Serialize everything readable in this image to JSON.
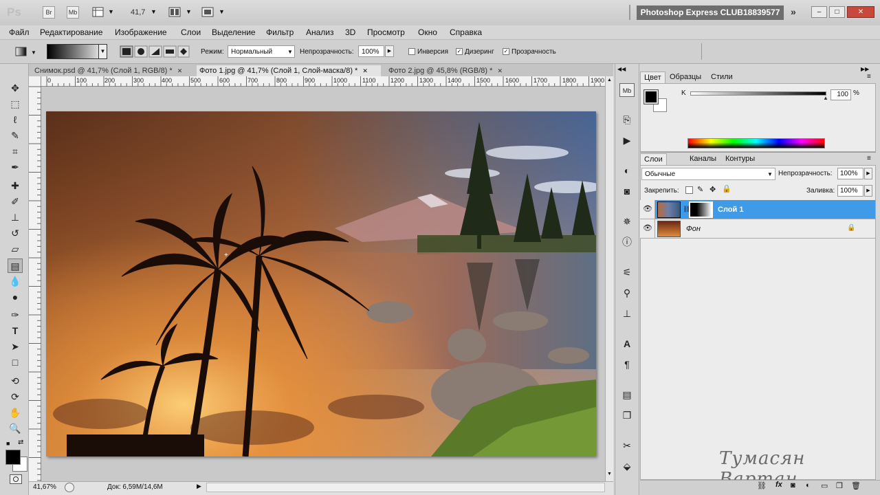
{
  "app": {
    "logo": "Ps",
    "bridge_label": "Br",
    "minibridge_label": "Mb",
    "zoom_value": "41,7",
    "workspace_name": "Photoshop Express CLUB18839577",
    "more_icon": "»"
  },
  "window_controls": {
    "minimize": "–",
    "maximize": "□",
    "close": "✕"
  },
  "menu": [
    "Файл",
    "Редактирование",
    "Изображение",
    "Слои",
    "Выделение",
    "Фильтр",
    "Анализ",
    "3D",
    "Просмотр",
    "Окно",
    "Справка"
  ],
  "options": {
    "mode_label": "Режим:",
    "mode_value": "Нормальный",
    "opacity_label": "Непрозрачность:",
    "opacity_value": "100%",
    "inverse_label": "Инверсия",
    "dither_label": "Дизеринг",
    "transparency_label": "Прозрачность",
    "inverse_checked": false,
    "dither_checked": true,
    "transparency_checked": true
  },
  "tabs": [
    {
      "label": "Снимок.psd @ 41,7% (Слой 1, RGB/8) *",
      "active": false
    },
    {
      "label": "Фото 1.jpg @ 41,7% (Слой 1, Слой-маска/8) *",
      "active": true
    },
    {
      "label": "Фото 2.jpg @ 45,8% (RGB/8) *",
      "active": false
    }
  ],
  "tab_close": "✕",
  "ruler_marks": [
    "0",
    "100",
    "200",
    "300",
    "400",
    "500",
    "600",
    "700",
    "800",
    "900",
    "1000",
    "1100",
    "1200",
    "1300",
    "1400",
    "1500",
    "1600",
    "1700",
    "1800",
    "1900"
  ],
  "status": {
    "zoom": "41,67%",
    "doc": "Док: 6,59M/14,6M"
  },
  "color_panel": {
    "tabs": [
      "Цвет",
      "Образцы",
      "Стили"
    ],
    "channel_label": "K",
    "value": "100",
    "unit": "%",
    "foreground": "#000000",
    "background": "#ffffff"
  },
  "layers_panel": {
    "tabs": [
      "Слои",
      "Каналы",
      "Контуры"
    ],
    "blend_mode": "Обычные",
    "opacity_label": "Непрозрачность:",
    "opacity_value": "100%",
    "lock_label": "Закрепить:",
    "fill_label": "Заливка:",
    "fill_value": "100%",
    "layers": [
      {
        "name": "Слой 1",
        "selected": true,
        "has_mask": true
      },
      {
        "name": "Фон",
        "selected": false,
        "locked": true
      }
    ]
  },
  "signature": "Тумасян Вартан",
  "accent_color": "#3f9ae8"
}
